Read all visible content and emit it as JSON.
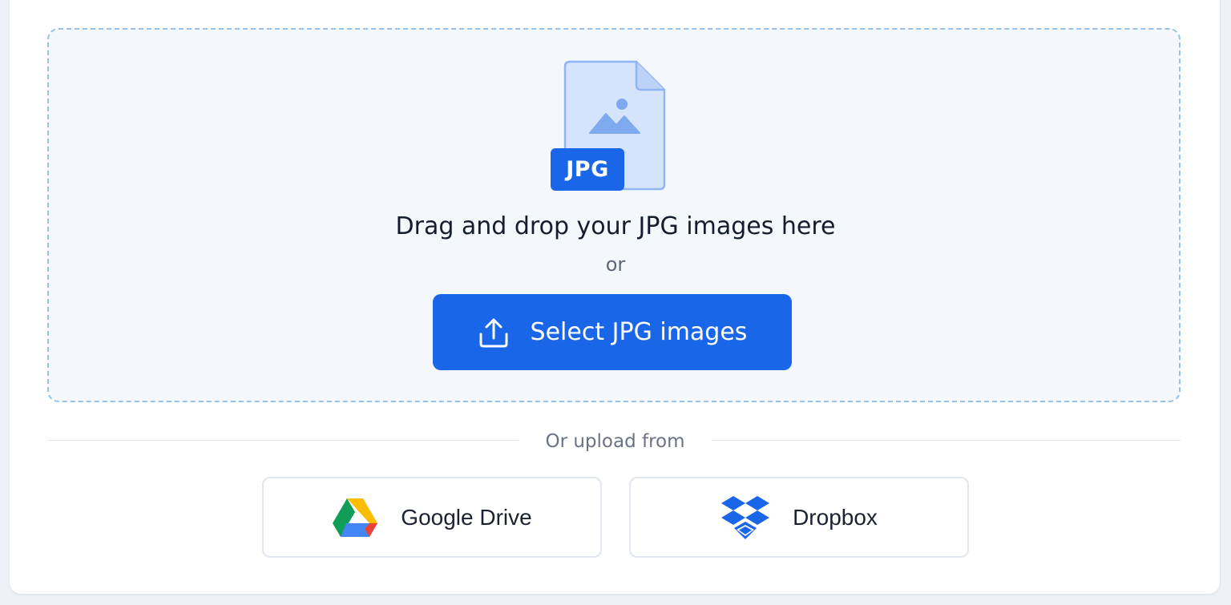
{
  "upload_area": {
    "badge_text": "JPG",
    "title": "Drag and drop your JPG images here",
    "or_text": "or",
    "select_button_label": "Select JPG images"
  },
  "divider": {
    "text": "Or upload from"
  },
  "sources": [
    {
      "label": "Google Drive",
      "icon": "google-drive-icon"
    },
    {
      "label": "Dropbox",
      "icon": "dropbox-icon"
    }
  ],
  "colors": {
    "primary": "#1a66e8",
    "dropzone_border": "#93c3ec",
    "dropzone_bg": "#f4f8fd",
    "text_dark": "#141c2e",
    "text_muted": "#5d6677",
    "page_bg": "#eef2f7"
  }
}
